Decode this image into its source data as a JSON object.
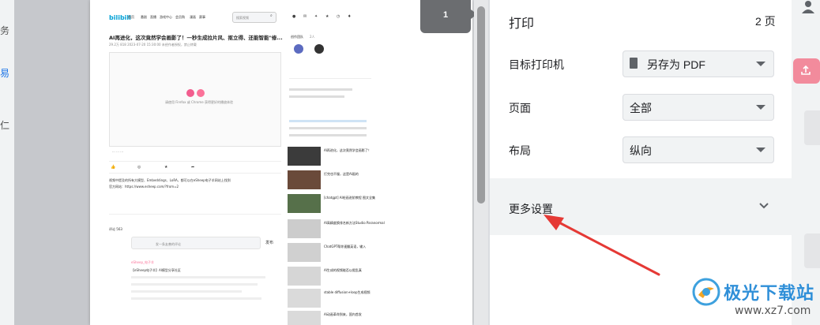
{
  "print_panel": {
    "title": "打印",
    "page_count": "2 页",
    "destination_label": "目标打印机",
    "destination_value": "另存为 PDF",
    "pages_label": "页面",
    "pages_value": "全部",
    "layout_label": "布局",
    "layout_value": "纵向",
    "more_settings": "更多设置"
  },
  "preview": {
    "page_number": "1",
    "nav": [
      "首页",
      "番剧",
      "直播",
      "游戏中心",
      "会员购",
      "漫画",
      "赛事"
    ],
    "search_placeholder": "搜索视频",
    "article_title": "AI再进化，这次竟然学会画影了！一秒生成拉片风、抠立得、还能智能\"修...",
    "meta": "29.2万   818   2023-07-20 15:30:00   未经作者授权，禁止转载",
    "player_note": "请使用 Firefox 或 Chrome 获得更好的播放体验",
    "sidebar_title": "创作团队",
    "sidebar_count": "2人",
    "desc_line1": "视频中提及的所有大模型、Embeddings、LoRA，都可以在eSheep电子羊网站上找到",
    "desc_line2": "官方网站：https://www.esheep.com/?from=2",
    "related_items": [
      "AI再进化，这次竟然学会画影了！",
      "打完也不服，这是AI画的",
      "[chatgpt] AI绘画进阶教程 图文全集",
      "AI高精度换排名新方法Studio Paranormal",
      "ChatGPT帮你速翻英语，输入",
      "AI生成的视频能否以假乱真",
      "stable diffusion+loop生成视频",
      "AI动画革命到来，国内首发"
    ],
    "comment_box_placeholder": "发一条友善的评论",
    "comment_send": "发布",
    "comment_header": "评论 563",
    "comment_user": "eSheep_电子羊",
    "comment_text": "【eSheep电子羊】AI模型分享社区"
  },
  "left_strip_chars": [
    "务",
    "易",
    "仁"
  ],
  "watermark": {
    "text": "极光下载站",
    "url": "www.xz7.com"
  },
  "colors": {
    "accent_red": "#e53935",
    "badge_gray": "#6b6d70",
    "panel_bg": "#ffffff",
    "more_bg": "#f1f3f4"
  }
}
